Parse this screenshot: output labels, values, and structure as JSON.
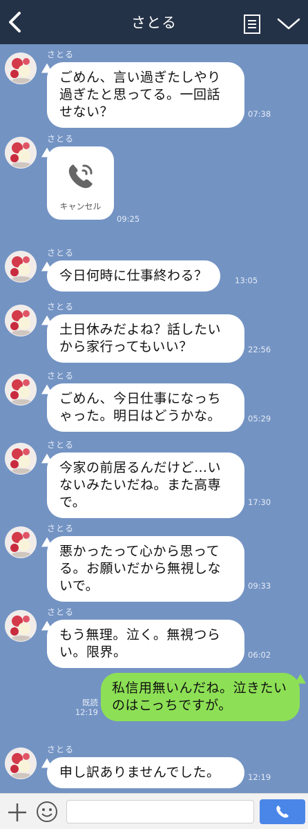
{
  "header": {
    "title": "さとる",
    "back_icon": "chevron-left-icon",
    "memo_icon": "notes-icon",
    "menu_icon": "chevron-down-icon"
  },
  "messages": [
    {
      "sender": "さとる",
      "text": "ごめん、言い過ぎたしやり過ぎたと思ってる。一回話せない？",
      "time": "07:38"
    },
    {
      "sender": "さとる",
      "type": "call",
      "call_label": "キャンセル",
      "time": "09:25"
    },
    {
      "sender": "さとる",
      "text": "今日何時に仕事終わる？",
      "time": "13:05"
    },
    {
      "sender": "さとる",
      "text": "土日休みだよね？話したいから家行ってもいい？",
      "time": "22:56"
    },
    {
      "sender": "さとる",
      "text": "ごめん、今日仕事になっちゃった。明日はどうかな。",
      "time": "05:29"
    },
    {
      "sender": "さとる",
      "text": "今家の前居るんだけど…いないみたいだね。また高専で。",
      "time": "17:30"
    },
    {
      "sender": "さとる",
      "text": "悪かったって心から思ってる。お願いだから無視しないで。",
      "time": "09:33"
    },
    {
      "sender": "さとる",
      "text": "もう無理。泣く。無視つらい。限界。",
      "time": "06:02"
    },
    {
      "sender": "さとる",
      "text": "申し訳ありませんでした。",
      "time": "12:19"
    }
  ],
  "my_message": {
    "text": "私信用無いんだね。泣きたいのはこっちですが。",
    "read_label": "既読",
    "time": "12:19"
  },
  "footer": {
    "plus_icon": "plus-icon",
    "emoji_icon": "emoji-icon",
    "input_value": "",
    "send_icon": "phone-send-icon"
  },
  "colors": {
    "background": "#7393c3",
    "header": "#243247",
    "my_bubble": "#8de055",
    "send_button": "#4a86e8"
  }
}
